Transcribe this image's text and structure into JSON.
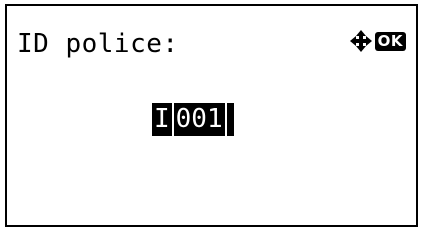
{
  "screen": {
    "title": "ID police:",
    "nav_icons": {
      "dpad": "four-way-arrow-icon",
      "ok": "OK"
    },
    "id_entry": {
      "prefix": "I",
      "digits": "001"
    }
  },
  "colors": {
    "foreground": "#000000",
    "background": "#ffffff"
  }
}
